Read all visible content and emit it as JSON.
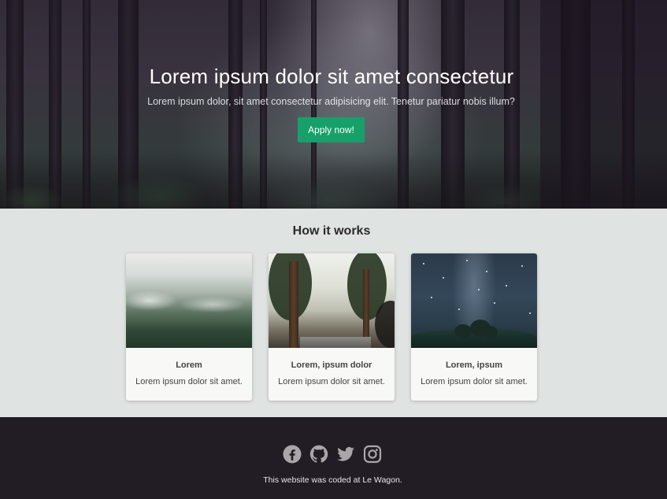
{
  "hero": {
    "title": "Lorem ipsum dolor sit amet consectetur",
    "subtitle": "Lorem ipsum dolor, sit amet consectetur adipisicing elit. Tenetur pariatur nobis illum?",
    "cta_label": "Apply now!",
    "cta_color": "#18a06a"
  },
  "how": {
    "title": "How it works",
    "cards": [
      {
        "title": "Lorem",
        "text": "Lorem ipsum dolor sit amet.",
        "image_icon": "foggy-forest-image"
      },
      {
        "title": "Lorem, ipsum dolor",
        "text": "Lorem ipsum dolor sit amet.",
        "image_icon": "forest-road-image"
      },
      {
        "title": "Lorem, ipsum",
        "text": "Lorem ipsum dolor sit amet.",
        "image_icon": "starry-sky-image"
      }
    ]
  },
  "footer": {
    "text": "This website was coded at Le Wagon.",
    "social_icons": [
      "facebook-icon",
      "github-icon",
      "twitter-icon",
      "instagram-icon"
    ],
    "background": "#221c24",
    "icon_color": "#a9a6aa"
  }
}
